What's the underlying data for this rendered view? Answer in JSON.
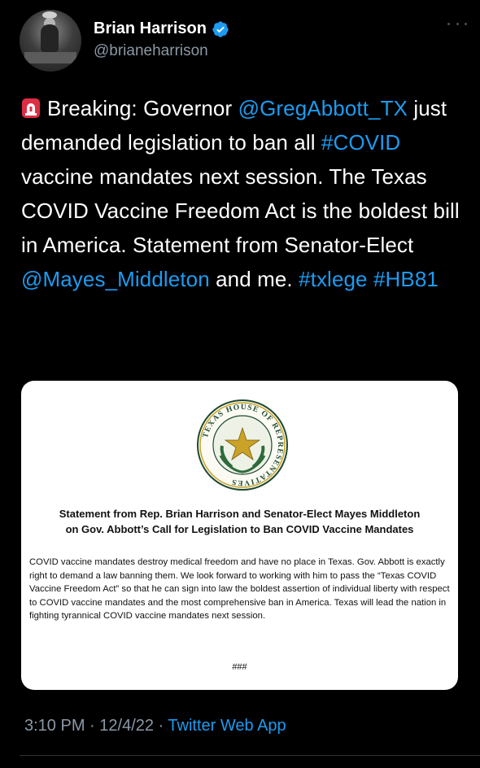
{
  "author": {
    "name": "Brian Harrison",
    "handle": "@brianeharrison",
    "verified_color": "#1d9bf0",
    "avatar_icon": "avatar-photo"
  },
  "tweet": {
    "emoji_icon": "police-siren-icon",
    "parts": [
      {
        "text": "Breaking: Governor ",
        "type": "text"
      },
      {
        "text": "@GregAbbott_TX",
        "type": "mention"
      },
      {
        "text": " just demanded legislation to ban all ",
        "type": "text"
      },
      {
        "text": "#COVID",
        "type": "hashtag"
      },
      {
        "text": " vaccine mandates next session. The Texas COVID Vaccine Freedom Act is the boldest bill in America. Statement from Senator-Elect ",
        "type": "text"
      },
      {
        "text": "@Mayes_Middleton",
        "type": "mention"
      },
      {
        "text": " and me.  ",
        "type": "text"
      },
      {
        "text": "#txlege",
        "type": "hashtag"
      },
      {
        "text": " ",
        "type": "text"
      },
      {
        "text": "#HB81",
        "type": "hashtag"
      }
    ]
  },
  "image_card": {
    "seal_text": "TEXAS HOUSE OF REPRESENTATIVES",
    "title_line1": "Statement from Rep. Brian Harrison and Senator-Elect Mayes Middleton",
    "title_line2": "on Gov. Abbott’s Call for Legislation to Ban COVID Vaccine Mandates",
    "body": "COVID vaccine mandates destroy medical freedom and have no place in Texas.  Gov. Abbott is exactly right to demand a law banning them.  We look forward to working with him to pass the “Texas COVID Vaccine Freedom Act” so that he can sign into law the boldest assertion of individual liberty with respect to COVID vaccine mandates and the most comprehensive ban in America. Texas will lead the nation in fighting tyrannical COVID vaccine mandates next session.",
    "end_mark": "###"
  },
  "meta": {
    "time": "3:10 PM",
    "separator": " · ",
    "date": "12/4/22",
    "app": "Twitter Web App"
  },
  "colors": {
    "background": "#000000",
    "text": "#ffffff",
    "link": "#1d9bf0",
    "muted": "#8b98a5"
  }
}
